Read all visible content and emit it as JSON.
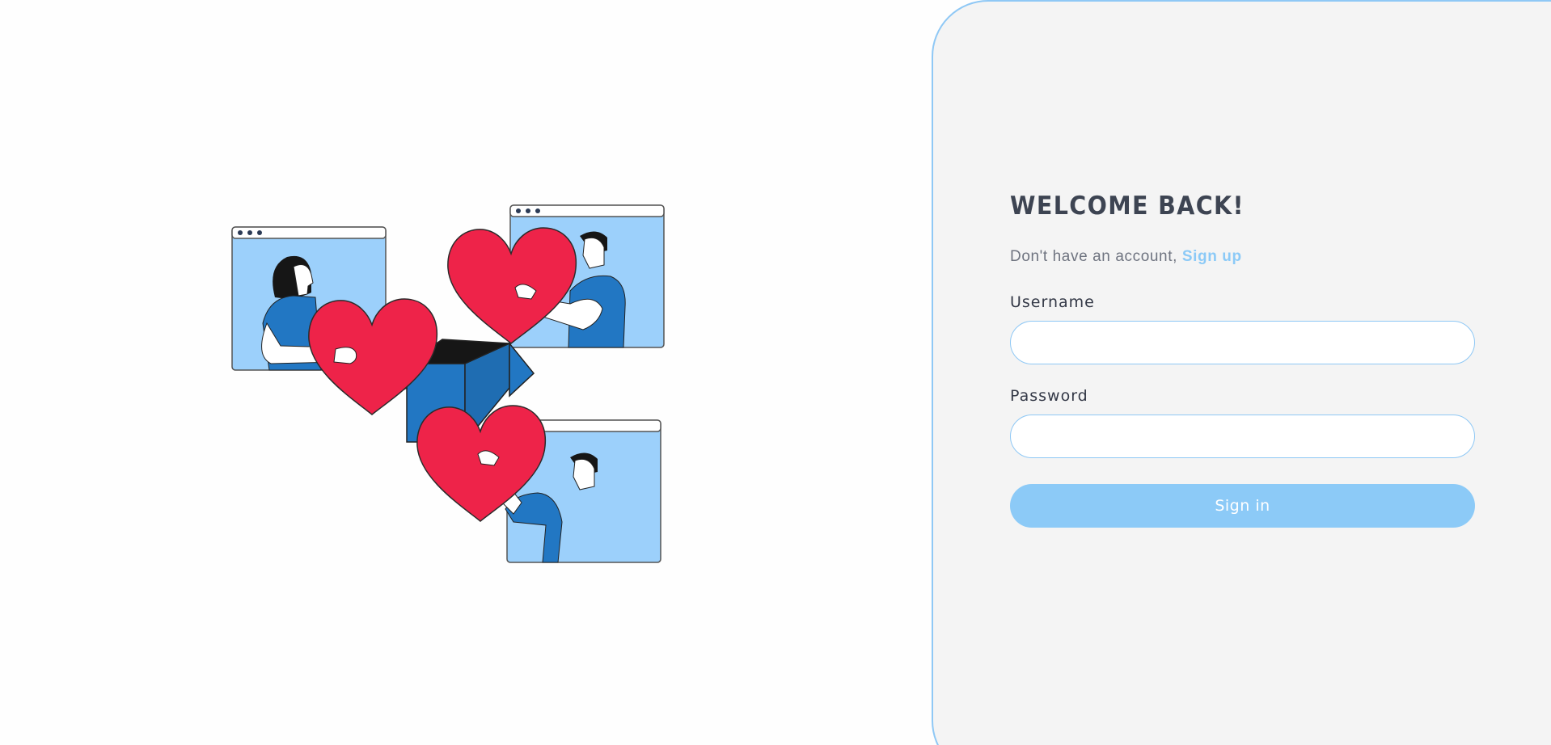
{
  "illustration": {
    "name": "heart-exchange-illustration",
    "colors": {
      "heart": "#ee2349",
      "window": "#9cd0fb",
      "shirt": "#2277c3",
      "box_top": "#161616",
      "outline": "#2b2b2b"
    }
  },
  "login": {
    "title": "WELCOME BACK!",
    "signup_prompt": "Don't have an account,",
    "signup_link": "Sign up",
    "username_label": "Username",
    "username_value": "",
    "password_label": "Password",
    "password_value": "",
    "submit_label": "Sign in"
  },
  "theme": {
    "accent": "#8ccaf7",
    "panel_background": "#f4f4f4",
    "text_dark": "#3d4452"
  }
}
